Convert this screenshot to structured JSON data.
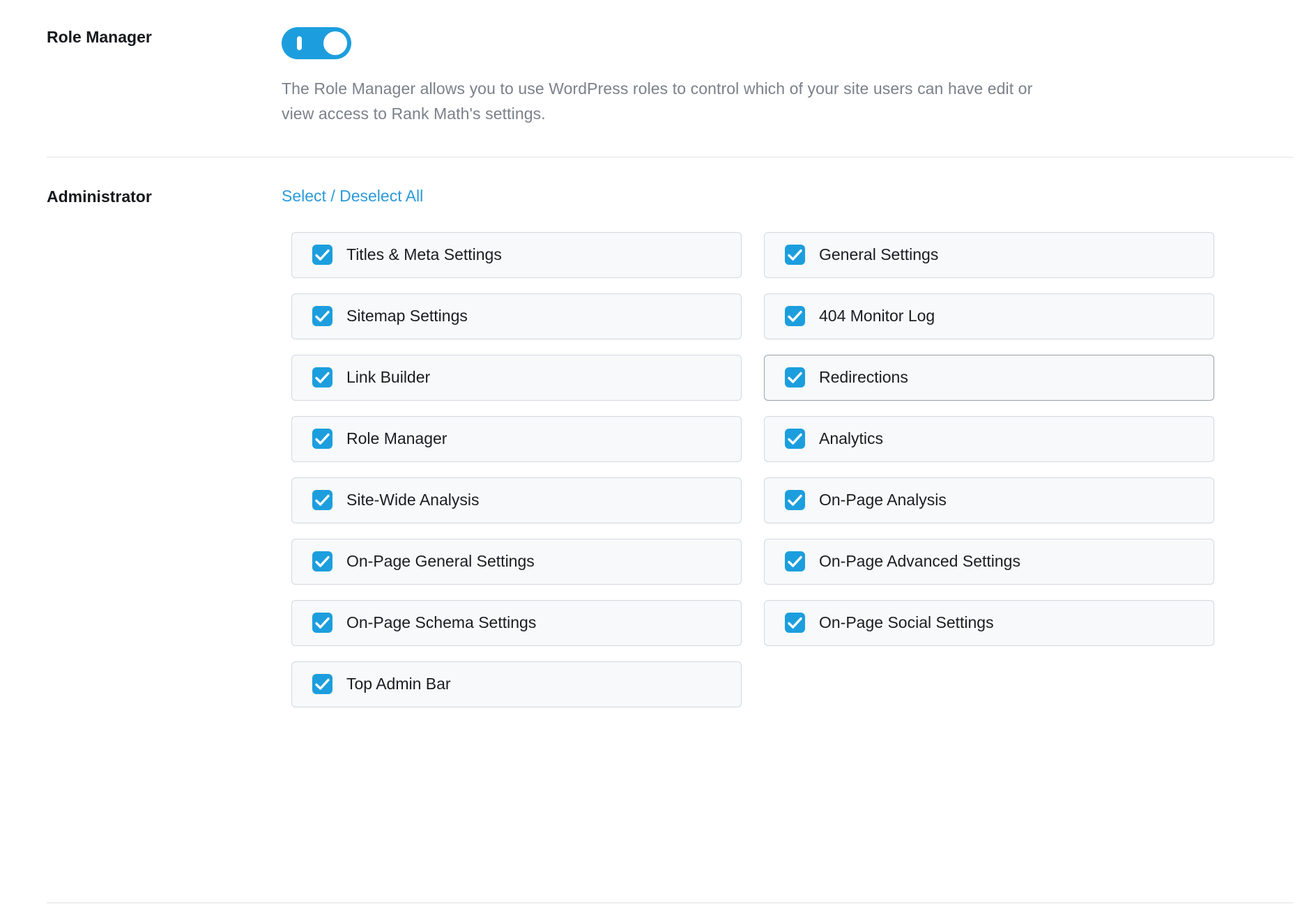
{
  "role_manager_section": {
    "label": "Role Manager",
    "toggle": {
      "name": "role-manager-toggle",
      "state": "on",
      "color": "#1c9ede"
    },
    "description": "The Role Manager allows you to use WordPress roles to control which of your site users can have edit or view access to Rank Math's settings."
  },
  "administrator_section": {
    "label": "Administrator",
    "select_deselect_all": "Select / Deselect All",
    "capabilities": [
      {
        "label": "Titles & Meta Settings",
        "checked": true,
        "focused": false
      },
      {
        "label": "General Settings",
        "checked": true,
        "focused": false
      },
      {
        "label": "Sitemap Settings",
        "checked": true,
        "focused": false
      },
      {
        "label": "404 Monitor Log",
        "checked": true,
        "focused": false
      },
      {
        "label": "Link Builder",
        "checked": true,
        "focused": false
      },
      {
        "label": "Redirections",
        "checked": true,
        "focused": true
      },
      {
        "label": "Role Manager",
        "checked": true,
        "focused": false
      },
      {
        "label": "Analytics",
        "checked": true,
        "focused": false
      },
      {
        "label": "Site-Wide Analysis",
        "checked": true,
        "focused": false
      },
      {
        "label": "On-Page Analysis",
        "checked": true,
        "focused": false
      },
      {
        "label": "On-Page General Settings",
        "checked": true,
        "focused": false
      },
      {
        "label": "On-Page Advanced Settings",
        "checked": true,
        "focused": false
      },
      {
        "label": "On-Page Schema Settings",
        "checked": true,
        "focused": false
      },
      {
        "label": "On-Page Social Settings",
        "checked": true,
        "focused": false
      },
      {
        "label": "Top Admin Bar",
        "checked": true,
        "focused": false
      }
    ]
  },
  "colors": {
    "accent_blue": "#1c9ede",
    "link_blue": "#2b9ad9",
    "item_background": "#f7f9fa",
    "item_border": "#d3d8de",
    "item_border_focused": "#9aa1ab",
    "divider": "#e0e2e5",
    "label_text": "#17181c",
    "description_text": "#7b808a"
  }
}
